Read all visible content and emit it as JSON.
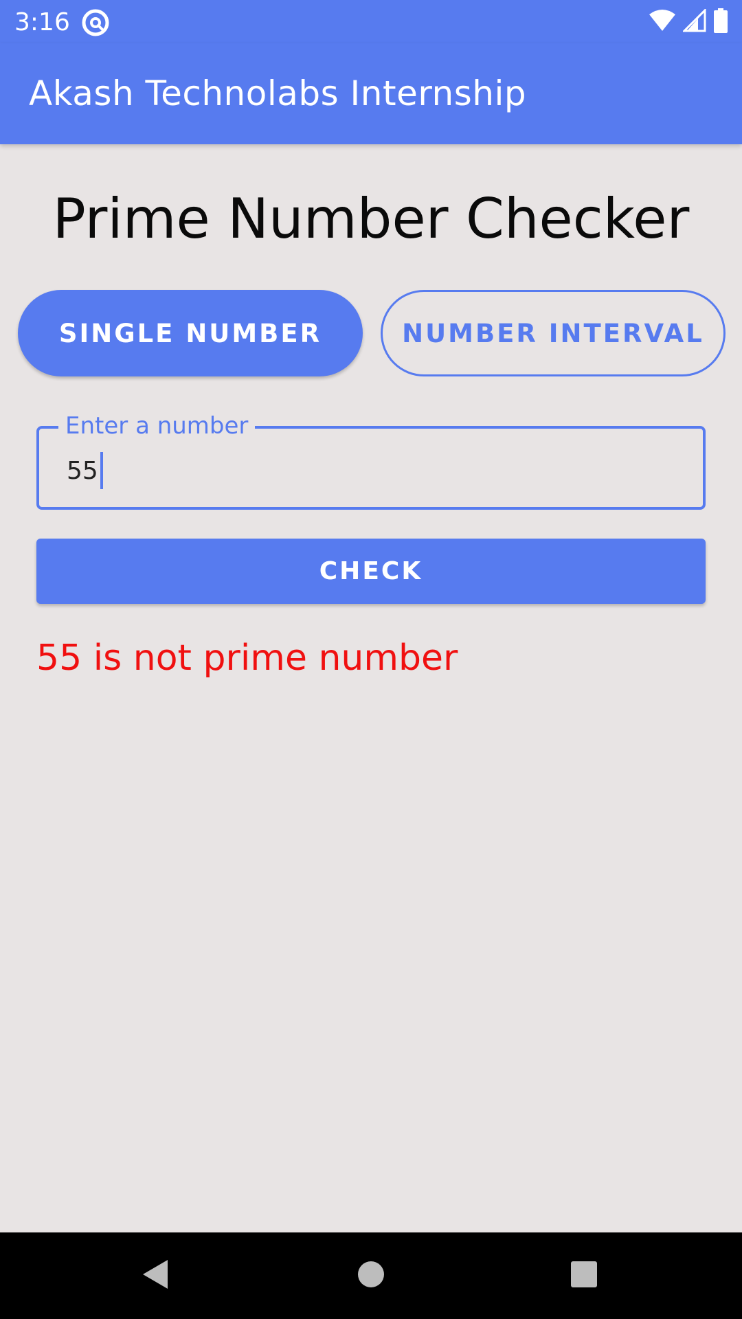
{
  "status_bar": {
    "time": "3:16"
  },
  "app_bar": {
    "title": "Akash Technolabs Internship"
  },
  "page": {
    "title": "Prime Number Checker"
  },
  "modes": {
    "single_label": "SINGLE NUMBER",
    "interval_label": "NUMBER INTERVAL",
    "selected": "SINGLE NUMBER"
  },
  "input": {
    "label": "Enter a number",
    "value": "55"
  },
  "check_button": {
    "label": "CHECK"
  },
  "result": {
    "text": "55 is not prime number"
  },
  "colors": {
    "primary": "#577BEF",
    "background": "#E8E4E4",
    "result_text": "#F01010"
  },
  "icons": {
    "status_app": "at-sign-icon",
    "wifi": "wifi-icon",
    "signal": "cell-signal-icon",
    "battery": "battery-icon",
    "nav_back": "back-triangle-icon",
    "nav_home": "home-circle-icon",
    "nav_recents": "recents-square-icon"
  }
}
